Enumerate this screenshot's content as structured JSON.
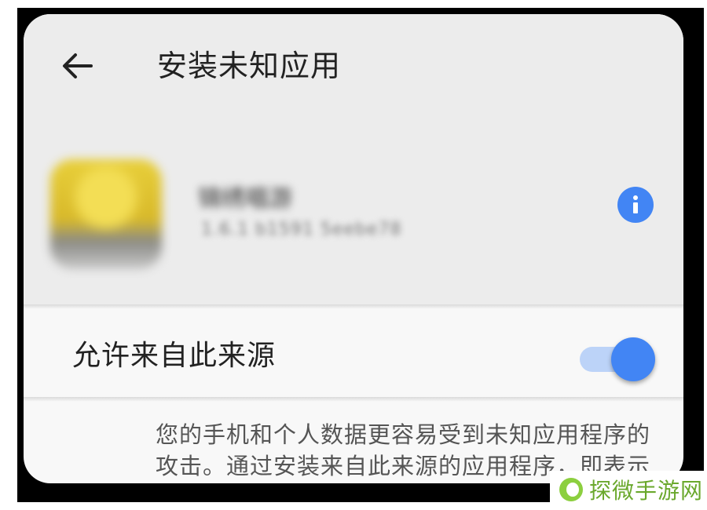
{
  "header": {
    "title": "安装未知应用",
    "back_icon": "arrow-left-icon"
  },
  "app": {
    "icon": "app-icon",
    "name": "锦绣唱游",
    "version": "1.6.1 b1591 5eebe78",
    "info_icon": "info-icon"
  },
  "toggle": {
    "label": "允许来自此来源",
    "enabled": true
  },
  "warning": {
    "text": "您的手机和个人数据更容易受到未知应用程序的攻击。通过安装来自此来源的应用程序，即表示您同意，对手机造成的任何损坏"
  },
  "watermark": {
    "text": "探微手游网",
    "icon": "leaf-logo-icon"
  },
  "colors": {
    "accent": "#4285f4",
    "header_bg": "#ececec",
    "body_bg": "#f8f8f8",
    "watermark": "#6aa82c"
  }
}
